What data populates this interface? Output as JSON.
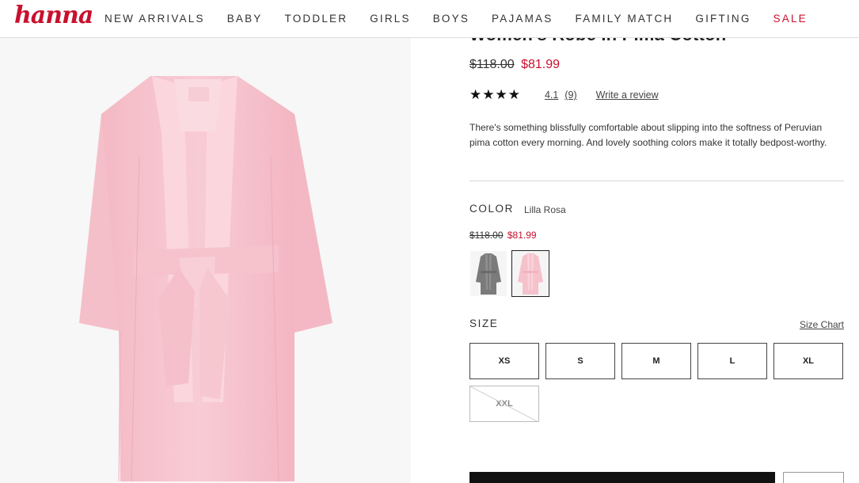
{
  "header": {
    "logo_text": "hanna",
    "nav": [
      {
        "label": "NEW ARRIVALS",
        "sale": false
      },
      {
        "label": "BABY",
        "sale": false
      },
      {
        "label": "TODDLER",
        "sale": false
      },
      {
        "label": "GIRLS",
        "sale": false
      },
      {
        "label": "BOYS",
        "sale": false
      },
      {
        "label": "PAJAMAS",
        "sale": false
      },
      {
        "label": "FAMILY MATCH",
        "sale": false
      },
      {
        "label": "GIFTING",
        "sale": false
      },
      {
        "label": "SALE",
        "sale": true
      }
    ]
  },
  "product": {
    "title": "Women's Robe In Pima Cotton",
    "price_original": "$118.00",
    "price_sale": "$81.99",
    "rating": {
      "stars_display": "★★★★",
      "value": "4.1",
      "count": "(9)",
      "write_review": "Write a review",
      "stars": 4.1
    },
    "description": "There's something blissfully comfortable about slipping into the softness of Peruvian pima cotton every morning. And lovely soothing colors make it totally bedpost-worthy."
  },
  "color": {
    "label": "COLOR",
    "selected": "Lilla Rosa",
    "price_original": "$118.00",
    "price_sale": "$81.99",
    "swatches": [
      {
        "icon": "gray-robe-thumbnail",
        "color": "#7b7b7b",
        "selected": false
      },
      {
        "icon": "pink-robe-thumbnail",
        "color": "#f7c6cf",
        "selected": true
      }
    ]
  },
  "size": {
    "label": "SIZE",
    "size_chart": "Size Chart",
    "options": [
      {
        "label": "XS",
        "available": true
      },
      {
        "label": "S",
        "available": true
      },
      {
        "label": "M",
        "available": true
      },
      {
        "label": "L",
        "available": true
      },
      {
        "label": "XL",
        "available": true
      },
      {
        "label": "XXL",
        "available": false
      }
    ]
  },
  "colors": {
    "brand_red": "#c8102e",
    "robe_pink": "#f7c6cf",
    "cta_black": "#111111"
  }
}
